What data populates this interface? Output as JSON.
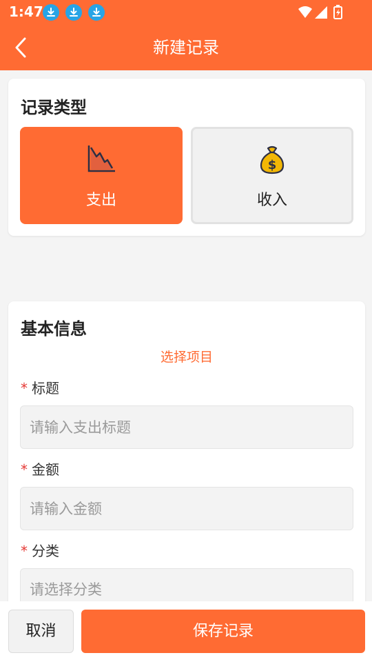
{
  "status_bar": {
    "time": "1:47",
    "notification_icons": [
      "download-icon",
      "download-icon",
      "download-icon"
    ],
    "system_icons": [
      "wifi-icon",
      "signal-icon",
      "battery-charging-icon"
    ]
  },
  "nav": {
    "title": "新建记录",
    "back_icon": "chevron-left-icon"
  },
  "record_type": {
    "title": "记录类型",
    "options": [
      {
        "label": "支出",
        "icon": "chart-down-icon",
        "selected": true
      },
      {
        "label": "收入",
        "icon": "money-bag-icon",
        "selected": false
      }
    ]
  },
  "basic_info": {
    "title": "基本信息",
    "select_project": "选择项目",
    "required_mark": "*",
    "fields": {
      "title": {
        "label": "标题",
        "placeholder": "请输入支出标题",
        "value": ""
      },
      "amount": {
        "label": "金额",
        "placeholder": "请输入金额",
        "value": ""
      },
      "category": {
        "label": "分类",
        "placeholder": "请选择分类"
      }
    }
  },
  "actions": {
    "cancel": "取消",
    "save": "保存记录"
  },
  "colors": {
    "primary": "#ff6b33",
    "required": "#e53935",
    "background": "#f4f4f4",
    "notification_blue": "#27a4e6",
    "money_bag": "#f2b705"
  }
}
